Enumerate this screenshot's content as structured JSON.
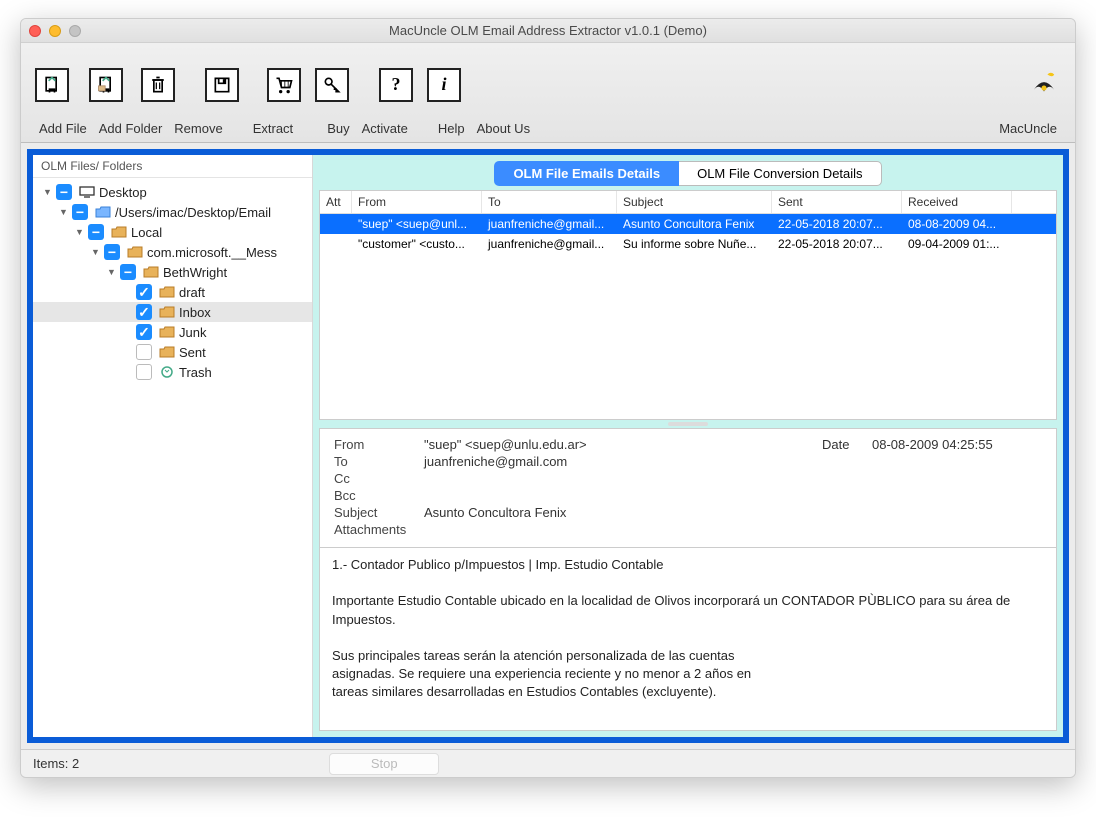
{
  "window": {
    "title": "MacUncle OLM Email Address Extractor v1.0.1 (Demo)"
  },
  "toolbar": {
    "add_file": "Add File",
    "add_folder": "Add Folder",
    "remove": "Remove",
    "extract": "Extract",
    "buy": "Buy",
    "activate": "Activate",
    "help": "Help",
    "about": "About Us",
    "brand": "MacUncle"
  },
  "sidebar": {
    "header": "OLM Files/ Folders",
    "tree": {
      "desktop": "Desktop",
      "path": "/Users/imac/Desktop/Email",
      "local": "Local",
      "com_ms": "com.microsoft.__Mess",
      "beth": "BethWright",
      "draft": "draft",
      "inbox": "Inbox",
      "junk": "Junk",
      "sent": "Sent",
      "trash": "Trash"
    }
  },
  "tabs": {
    "emails": "OLM File Emails Details",
    "conversion": "OLM File Conversion Details"
  },
  "table": {
    "headers": {
      "att": "Att",
      "from": "From",
      "to": "To",
      "subject": "Subject",
      "sent": "Sent",
      "received": "Received"
    },
    "rows": [
      {
        "att": "",
        "from": "\"suep\" <suep@unl...",
        "to": "juanfreniche@gmail...",
        "subject": "Asunto Concultora Fenix",
        "sent": "22-05-2018 20:07...",
        "received": "08-08-2009 04..."
      },
      {
        "att": "",
        "from": "\"customer\" <custo...",
        "to": "juanfreniche@gmail...",
        "subject": "Su informe sobre Nuñe...",
        "sent": "22-05-2018 20:07...",
        "received": "09-04-2009 01:..."
      }
    ]
  },
  "detail": {
    "from_label": "From",
    "from": "\"suep\" <suep@unlu.edu.ar>",
    "to_label": "To",
    "to": "juanfreniche@gmail.com",
    "cc_label": "Cc",
    "cc": "",
    "bcc_label": "Bcc",
    "bcc": "",
    "subject_label": "Subject",
    "subject": "Asunto Concultora Fenix",
    "attachments_label": "Attachments",
    "attachments": "",
    "date_label": "Date",
    "date": "08-08-2009 04:25:55",
    "body_line1": "1.- Contador Publico p/Impuestos | Imp. Estudio Contable",
    "body_line2": "Importante Estudio Contable ubicado en la localidad de Olivos incorporará un CONTADOR PÙBLICO para su área de Impuestos.",
    "body_line3": "Sus principales tareas serán la atención personalizada de las cuentas",
    "body_line4": "asignadas. Se requiere una experiencia reciente y no menor a 2 años en",
    "body_line5": "tareas similares desarrolladas en Estudios Contables (excluyente)."
  },
  "status": {
    "items": "Items:  2",
    "stop": "Stop"
  }
}
